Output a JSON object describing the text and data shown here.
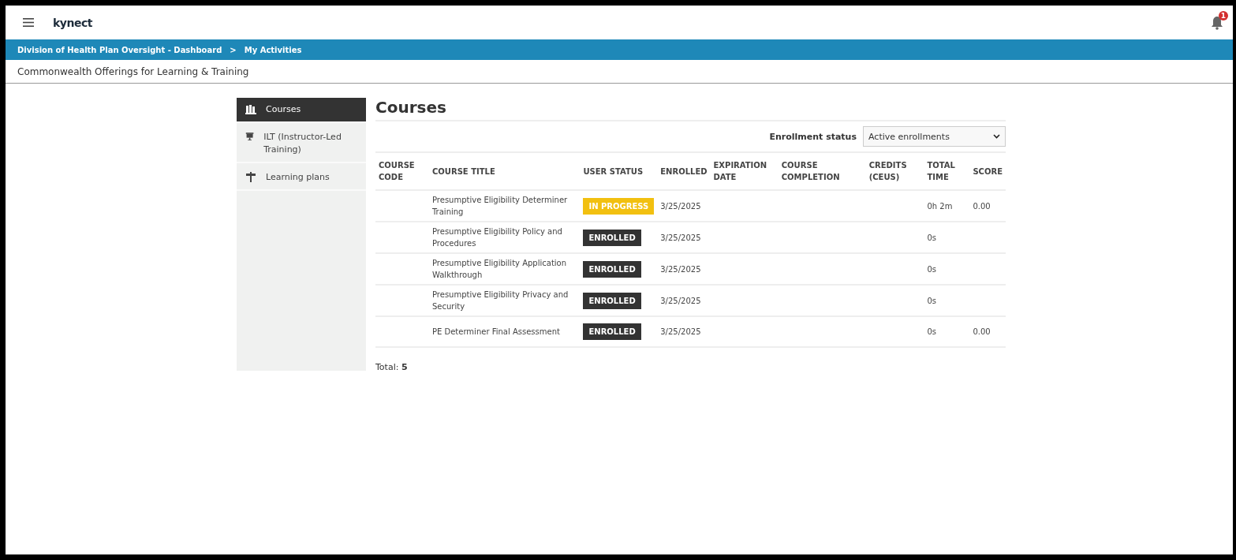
{
  "header": {
    "logo": "kynect",
    "notification_count": "1"
  },
  "breadcrumb": [
    {
      "label": "Division of Health Plan Oversight - Dashboard"
    },
    {
      "label": "My Activities"
    }
  ],
  "breadcrumb_separator": ">",
  "subtitle": "Commonwealth Offerings for Learning & Training",
  "sidebar": {
    "items": [
      {
        "label": "Courses",
        "selected": true
      },
      {
        "label": "ILT (Instructor-Led Training)",
        "selected": false
      },
      {
        "label": "Learning plans",
        "selected": false
      }
    ]
  },
  "page_title": "Courses",
  "filter": {
    "label": "Enrollment status",
    "value": "Active enrollments"
  },
  "table": {
    "columns": [
      "COURSE CODE",
      "COURSE TITLE",
      "USER STATUS",
      "ENROLLED",
      "EXPIRATION DATE",
      "COURSE COMPLETION",
      "CREDITS (CEUS)",
      "TOTAL TIME",
      "SCORE"
    ],
    "rows": [
      {
        "title": "Presumptive Eligibility Determiner Training",
        "status": {
          "kind": "in_progress",
          "label": "IN PROGRESS"
        },
        "enrolled": "3/25/2025",
        "total_time": "0h 2m",
        "score": "0.00"
      },
      {
        "title": "Presumptive Eligibility Policy and Procedures",
        "status": {
          "kind": "enrolled",
          "label": "ENROLLED"
        },
        "enrolled": "3/25/2025",
        "total_time": "0s"
      },
      {
        "title": "Presumptive Eligibility Application Walkthrough",
        "status": {
          "kind": "enrolled",
          "label": "ENROLLED"
        },
        "enrolled": "3/25/2025",
        "total_time": "0s"
      },
      {
        "title": "Presumptive Eligibility Privacy and Security",
        "status": {
          "kind": "enrolled",
          "label": "ENROLLED"
        },
        "enrolled": "3/25/2025",
        "total_time": "0s"
      },
      {
        "title": "PE Determiner Final Assessment",
        "status": {
          "kind": "enrolled",
          "label": "ENROLLED"
        },
        "enrolled": "3/25/2025",
        "total_time": "0s",
        "score": "0.00"
      }
    ]
  },
  "total": {
    "label": "Total:",
    "value": "5"
  }
}
